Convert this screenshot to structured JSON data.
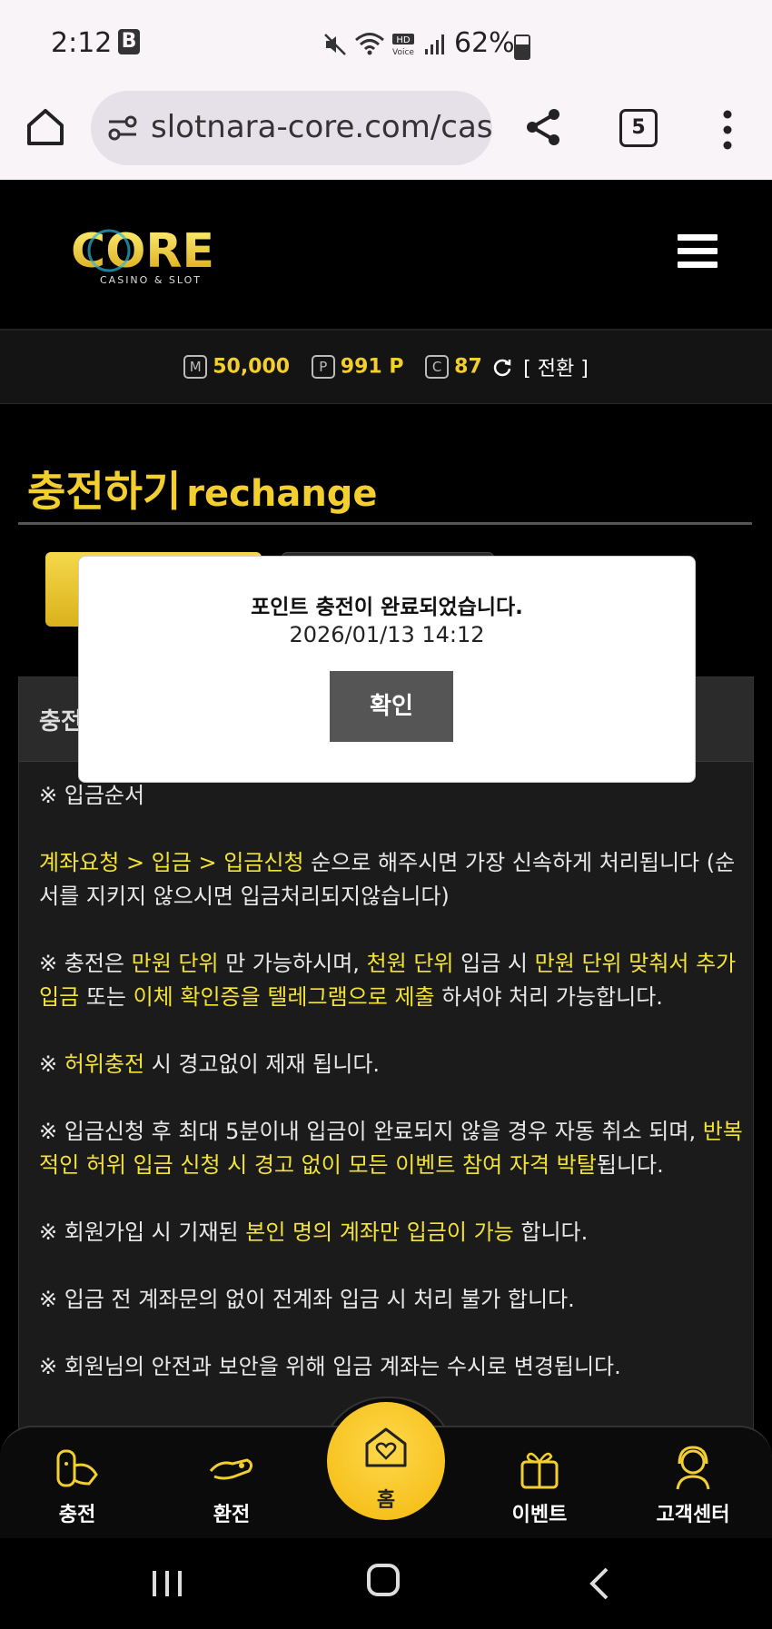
{
  "status_bar": {
    "time": "2:12",
    "b_icon": "B",
    "battery": "62%"
  },
  "browser": {
    "url": "slotnara-core.com/cas",
    "tab_count": "5"
  },
  "site": {
    "logo_text": "CORE",
    "logo_sub": "CASINO & SLOT"
  },
  "balances": {
    "money_badge": "M",
    "money": "50,000",
    "point_badge": "P",
    "point": "991 P",
    "comp_badge": "C",
    "comp": "87",
    "convert_label": "[ 전환 ]"
  },
  "page": {
    "title_ko": "충전하기",
    "title_en": "rechange",
    "content_header": "충전"
  },
  "notice": {
    "section_title": "※ 입금순서",
    "p1_h1": "계좌요청 > 입금 > 입금신청",
    "p1_t1": " 순으로 해주시면 가장 신속하게 처리됩니다 (순서를 지키지 않으시면 입금처리되지않습니다)",
    "p2_t1": "※ 충전은 ",
    "p2_h1": "만원 단위",
    "p2_t2": " 만 가능하시며, ",
    "p2_h2": "천원 단위",
    "p2_t3": " 입금 시 ",
    "p2_h3": "만원 단위 맞춰서 추가 입금",
    "p2_t4": " 또는 ",
    "p2_h4": "이체 확인증을 텔레그램으로 제출",
    "p2_t5": " 하셔야 처리 가능합니다.",
    "p3_t1": "※ ",
    "p3_h1": "허위충전",
    "p3_t2": " 시 경고없이 제재 됩니다.",
    "p4_t1": "※ 입금신청 후 최대 5분이내 입금이 완료되지 않을 경우 자동 취소 되며, ",
    "p4_h1": "반복적인 허위 입금 신청 시 경고 없이 모든 이벤트 참여 자격 박탈",
    "p4_t2": "됩니다.",
    "p5_t1": "※ 회원가입 시 기재된 ",
    "p5_h1": "본인 명의 계좌만 입금이 가능",
    "p5_t2": " 합니다.",
    "p6": "※ 입금 전 계좌문의 없이 전계좌 입금 시 처리 불가 합니다.",
    "p7": "※ 회원님의 안전과 보안을 위해 입금 계좌는 수시로 변경됩니다."
  },
  "modal": {
    "message": "포인트 충전이 완료되었습니다.",
    "timestamp": "2026/01/13 14:12",
    "ok_label": "확인"
  },
  "bottom_nav": [
    {
      "label": "충전",
      "icon": "deposit-icon"
    },
    {
      "label": "환전",
      "icon": "withdraw-icon"
    },
    {
      "label": "홈",
      "icon": "home-heart-icon"
    },
    {
      "label": "이벤트",
      "icon": "gift-icon"
    },
    {
      "label": "고객센터",
      "icon": "support-icon"
    }
  ],
  "colors": {
    "accent": "#f2cf2f",
    "highlight_text": "#f2e23a",
    "background": "#000000"
  }
}
